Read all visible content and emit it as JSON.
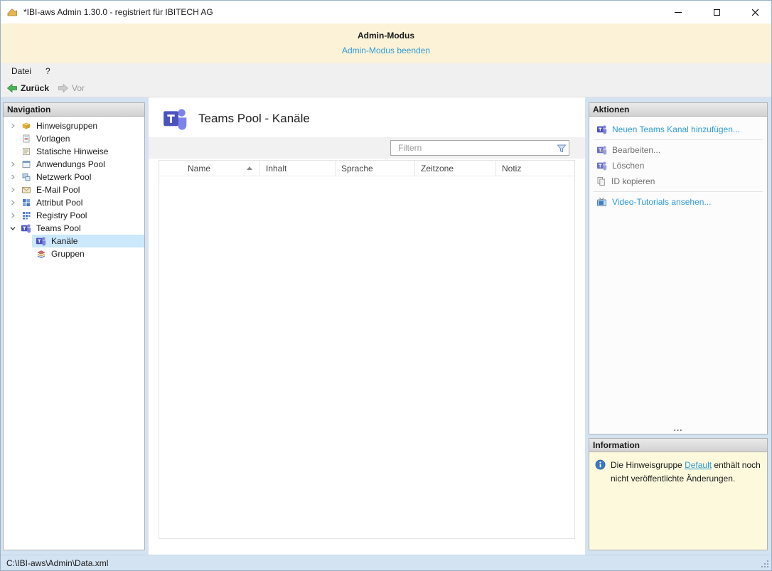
{
  "window": {
    "title": "*IBI-aws Admin 1.30.0 - registriert für IBITECH AG"
  },
  "admin_banner": {
    "title": "Admin-Modus",
    "link_label": "Admin-Modus beenden"
  },
  "menu": {
    "items": [
      {
        "label": "Datei"
      },
      {
        "label": "?"
      }
    ]
  },
  "toolbar": {
    "back_label": "Zurück",
    "forward_label": "Vor"
  },
  "navigation": {
    "header": "Navigation",
    "items": [
      {
        "label": "Hinweisgruppen"
      },
      {
        "label": "Vorlagen"
      },
      {
        "label": "Statische Hinweise"
      },
      {
        "label": "Anwendungs Pool"
      },
      {
        "label": "Netzwerk Pool"
      },
      {
        "label": "E-Mail Pool"
      },
      {
        "label": "Attribut Pool"
      },
      {
        "label": "Registry Pool"
      },
      {
        "label": "Teams Pool"
      },
      {
        "label": "Kanäle"
      },
      {
        "label": "Gruppen"
      }
    ]
  },
  "main": {
    "title": "Teams Pool - Kanäle",
    "filter_placeholder": "Filtern",
    "columns": [
      "Name",
      "Inhalt",
      "Sprache",
      "Zeitzone",
      "Notiz"
    ]
  },
  "actions": {
    "header": "Aktionen",
    "items": [
      {
        "label": "Neuen Teams Kanal hinzufügen..."
      },
      {
        "label": "Bearbeiten..."
      },
      {
        "label": "Löschen"
      },
      {
        "label": "ID kopieren"
      },
      {
        "label": "Video-Tutorials ansehen..."
      }
    ],
    "overflow": "..."
  },
  "information": {
    "header": "Information",
    "text_before": "Die Hinweisgruppe ",
    "link_label": "Default",
    "text_after": " enthält noch nicht veröffentlichte Änderungen."
  },
  "statusbar": {
    "path": "C:\\IBI-aws\\Admin\\Data.xml"
  },
  "colors": {
    "link_blue": "#2f9bd8",
    "teams_purple": "#4b53bc",
    "banner_yellow": "#fbf2d7",
    "selection_blue": "#cbe8fc",
    "info_yellow": "#fcf9dc"
  }
}
